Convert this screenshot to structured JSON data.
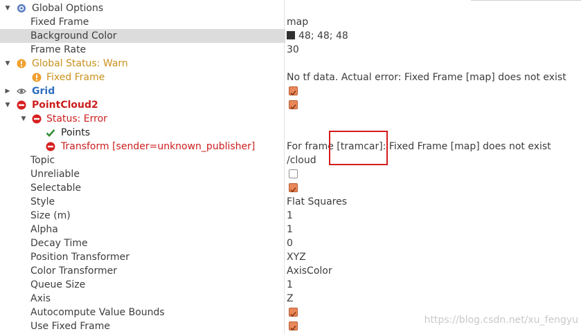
{
  "rows": {
    "global_options": {
      "label": "Global Options"
    },
    "fixed_frame": {
      "label": "Fixed Frame",
      "value": "map"
    },
    "background_color": {
      "label": "Background Color",
      "value": "48; 48; 48"
    },
    "frame_rate": {
      "label": "Frame Rate",
      "value": "30"
    },
    "global_status": {
      "label": "Global Status: Warn"
    },
    "status_fixed_frame": {
      "label": "Fixed Frame",
      "value": "No tf data.  Actual error: Fixed Frame [map] does not exist"
    },
    "grid": {
      "label": "Grid",
      "checked": true
    },
    "pointcloud2": {
      "label": "PointCloud2",
      "checked": true
    },
    "status_error": {
      "label": "Status: Error"
    },
    "points": {
      "label": "Points"
    },
    "transform": {
      "label": "Transform [sender=unknown_publisher]",
      "value": "For frame [tramcar]: Fixed Frame [map] does not exist"
    },
    "topic": {
      "label": "Topic",
      "value": "/cloud"
    },
    "unreliable": {
      "label": "Unreliable",
      "checked": false
    },
    "selectable": {
      "label": "Selectable",
      "checked": true
    },
    "style": {
      "label": "Style",
      "value": "Flat Squares"
    },
    "size": {
      "label": "Size (m)",
      "value": "1"
    },
    "alpha": {
      "label": "Alpha",
      "value": "1"
    },
    "decay_time": {
      "label": "Decay Time",
      "value": "0"
    },
    "position_transformer": {
      "label": "Position Transformer",
      "value": "XYZ"
    },
    "color_transformer": {
      "label": "Color Transformer",
      "value": "AxisColor"
    },
    "queue_size": {
      "label": "Queue Size",
      "value": "1"
    },
    "axis": {
      "label": "Axis",
      "value": "Z"
    },
    "autocompute": {
      "label": "Autocompute Value Bounds",
      "checked": true
    },
    "use_fixed_frame": {
      "label": "Use Fixed Frame",
      "checked": true
    }
  },
  "colors": {
    "warn": "#c8901c",
    "error": "#cc1e1e",
    "grid_blue": "#2f6ebf",
    "checkbox": "#e9885a",
    "highlight_box": "#d51a1a"
  },
  "icons": {
    "global_options": "gear-icon",
    "global_status": "warning-icon",
    "grid": "eye-icon",
    "pointcloud2": "error-icon",
    "points": "checkmark-icon"
  },
  "watermark": "https://blog.csdn.net/xu_fengyu"
}
